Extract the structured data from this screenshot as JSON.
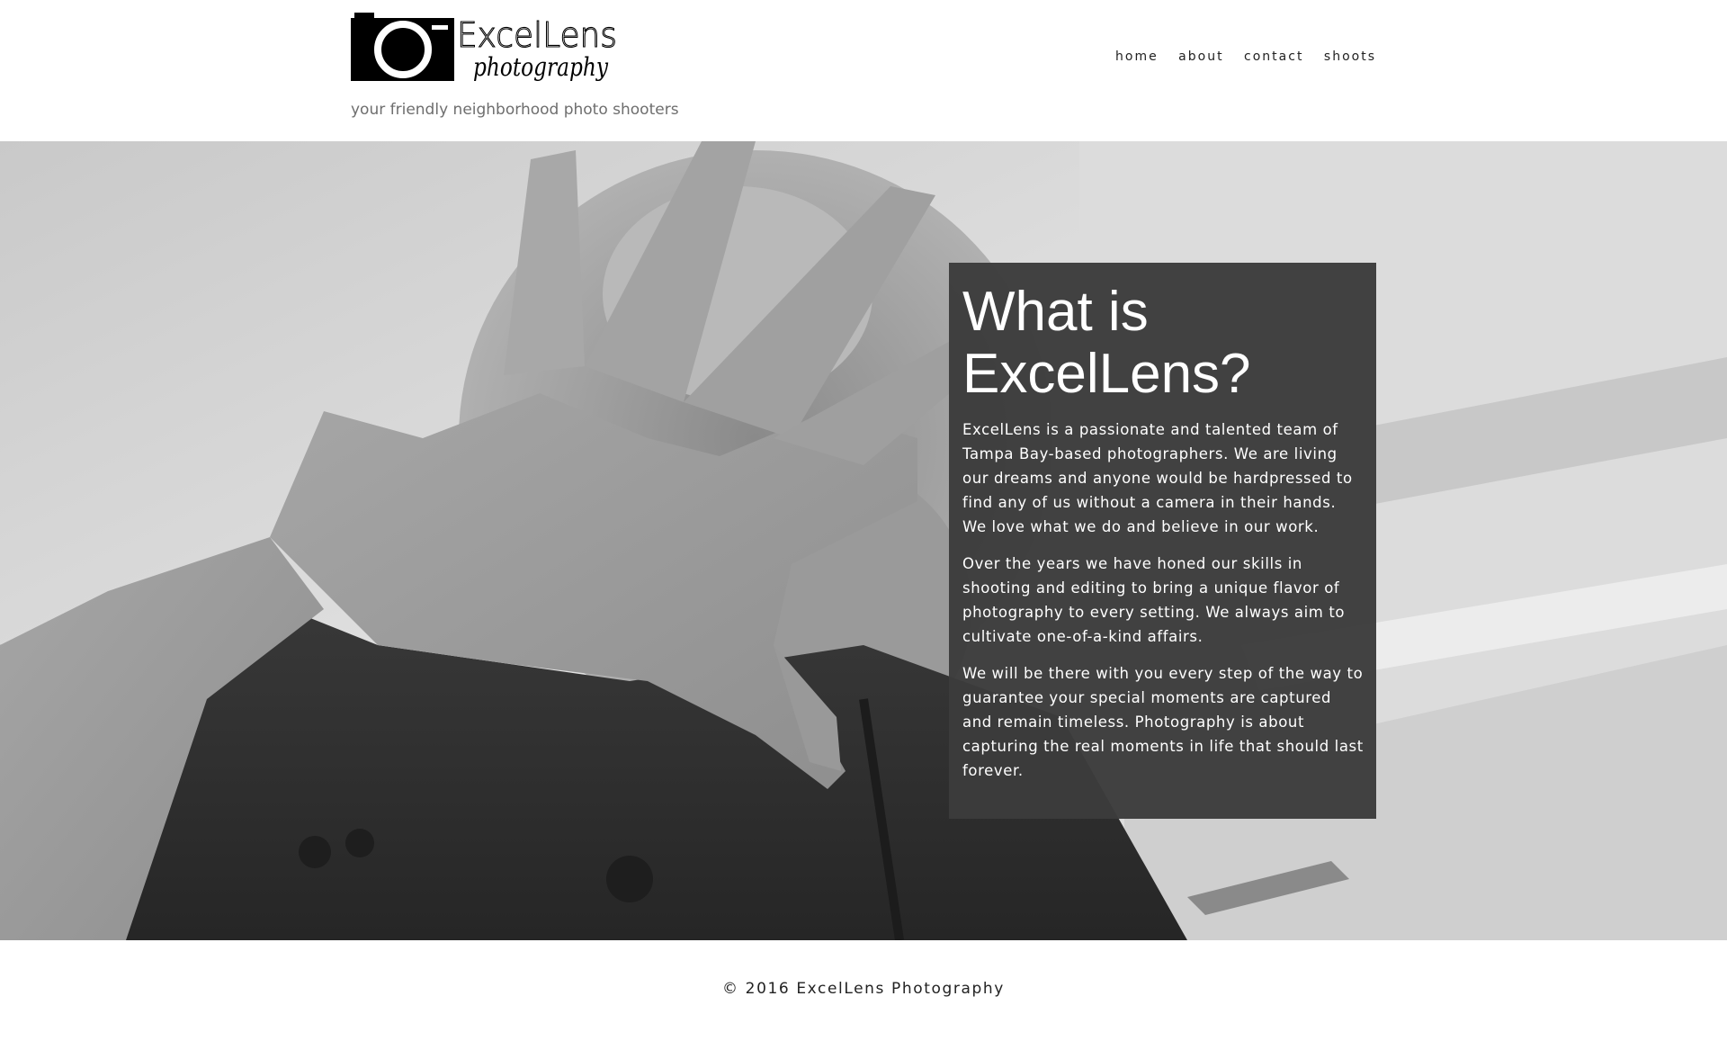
{
  "header": {
    "logo": {
      "wordmark": "ExcelLens",
      "script": "photography",
      "icon": "camera-icon"
    },
    "tagline": "your friendly neighborhood photo shooters",
    "nav": [
      {
        "label": "home"
      },
      {
        "label": "about"
      },
      {
        "label": "contact"
      },
      {
        "label": "shoots"
      }
    ]
  },
  "hero": {
    "image": "black-and-white photo of a person covering their face with an outstretched hand",
    "box": {
      "title": "What is ExcelLens?",
      "paragraphs": [
        "ExcelLens is a passionate and talented team of Tampa Bay-based  photographers. We are living our dreams and anyone would be hardpressed to find any of us without a camera in their hands. We love what we do and believe in our work.",
        "Over the years we have honed our skills in shooting and editing to bring a unique flavor of photography to every setting. We always aim to cultivate one-of-a-kind affairs.",
        "We will be there with you every step of the way to guarantee your special moments are captured and remain timeless. Photography is about capturing the real moments in life that should last forever."
      ]
    }
  },
  "footer": {
    "copyright": "© 2016 ExcelLens Photography"
  },
  "colors": {
    "box_background": "#3c3c3c",
    "nav_text": "#222222",
    "tagline_text": "#6e6e6e"
  }
}
